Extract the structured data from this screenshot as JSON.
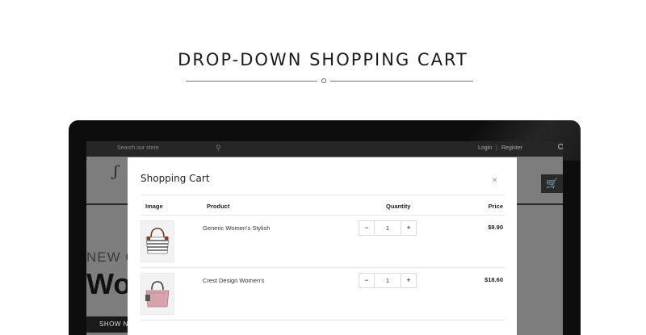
{
  "heading": {
    "title": "DROP-DOWN SHOPPING CART"
  },
  "store": {
    "search_placeholder": "Search our store",
    "login_label": "Login",
    "separator": "|",
    "register_label": "Register",
    "banner_subtitle": "NEW C",
    "banner_title": "Wo",
    "show_now_label": "SHOW NO"
  },
  "cart": {
    "title": "Shopping Cart",
    "close_symbol": "×",
    "columns": {
      "image": "Image",
      "product": "Product",
      "quantity": "Quantity",
      "price": "Price"
    },
    "items": [
      {
        "name": "Generic Women's Stylish",
        "qty": "1",
        "price": "$9.90",
        "image_icon": "striped-handbag"
      },
      {
        "name": "Crest Design Women's",
        "qty": "1",
        "price": "$18.60",
        "image_icon": "pink-handbag"
      }
    ],
    "minus_symbol": "−",
    "plus_symbol": "+"
  },
  "colors": {
    "modal_bg": "#ffffff",
    "monitor": "#0d0d0d",
    "overlay": "#7d7d7d",
    "topbar": "#262626"
  }
}
